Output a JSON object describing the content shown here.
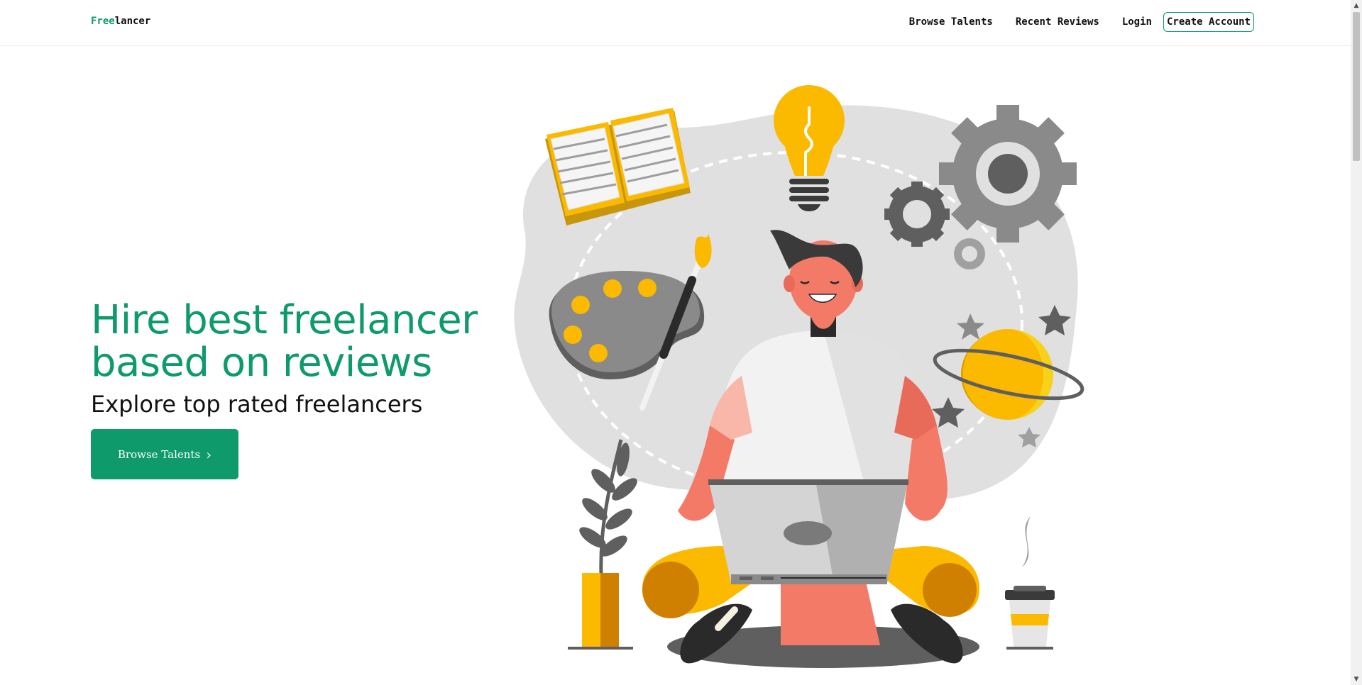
{
  "brand": {
    "prefix": "Free",
    "suffix": "lancer"
  },
  "nav": {
    "links": [
      "Browse Talents",
      "Recent Reviews",
      "Login"
    ],
    "cta_label": "Create Account"
  },
  "hero": {
    "title_line1": "Hire best freelancer",
    "title_line2": "based on reviews",
    "subtitle": "Explore top rated freelancers",
    "button_label": "Browse Talents",
    "button_icon": "chevron-right-icon"
  },
  "colors": {
    "accent": "#0e9a6b",
    "illustration_blob": "#e0e0e0",
    "illustration_yellow": "#fbb900",
    "illustration_skin": "#f47a68"
  }
}
